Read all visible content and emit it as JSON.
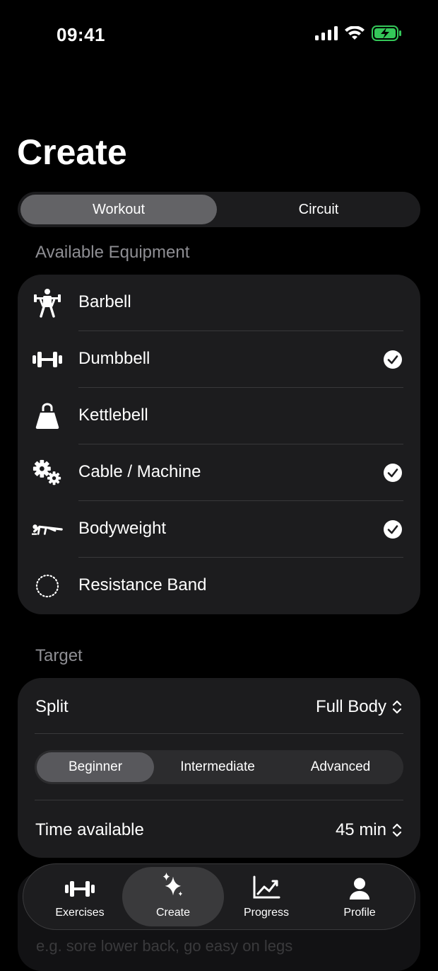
{
  "status_bar": {
    "time": "09:41"
  },
  "page": {
    "title": "Create"
  },
  "mode_tabs": [
    {
      "label": "Workout",
      "active": true
    },
    {
      "label": "Circuit",
      "active": false
    }
  ],
  "equipment": {
    "section_label": "Available Equipment",
    "items": [
      {
        "label": "Barbell",
        "icon": "barbell-lifter-icon",
        "checked": false
      },
      {
        "label": "Dumbbell",
        "icon": "dumbbell-icon",
        "checked": true
      },
      {
        "label": "Kettlebell",
        "icon": "kettlebell-icon",
        "checked": false
      },
      {
        "label": "Cable / Machine",
        "icon": "gears-icon",
        "checked": true
      },
      {
        "label": "Bodyweight",
        "icon": "pushup-icon",
        "checked": true
      },
      {
        "label": "Resistance Band",
        "icon": "dotted-circle-icon",
        "checked": false
      }
    ]
  },
  "target": {
    "section_label": "Target",
    "split_label": "Split",
    "split_value": "Full Body",
    "levels": [
      {
        "label": "Beginner",
        "active": true
      },
      {
        "label": "Intermediate",
        "active": false
      },
      {
        "label": "Advanced",
        "active": false
      }
    ],
    "time_label": "Time available",
    "time_value": "45 min"
  },
  "notes": {
    "placeholder": "e.g. sore lower back, go easy on legs"
  },
  "tab_bar": [
    {
      "label": "Exercises",
      "icon": "dumbbell-icon",
      "active": false
    },
    {
      "label": "Create",
      "icon": "sparkles-icon",
      "active": true
    },
    {
      "label": "Progress",
      "icon": "chart-icon",
      "active": false
    },
    {
      "label": "Profile",
      "icon": "person-icon",
      "active": false
    }
  ],
  "colors": {
    "background": "#000000",
    "card": "#1c1c1e",
    "accent_battery": "#34c759"
  }
}
